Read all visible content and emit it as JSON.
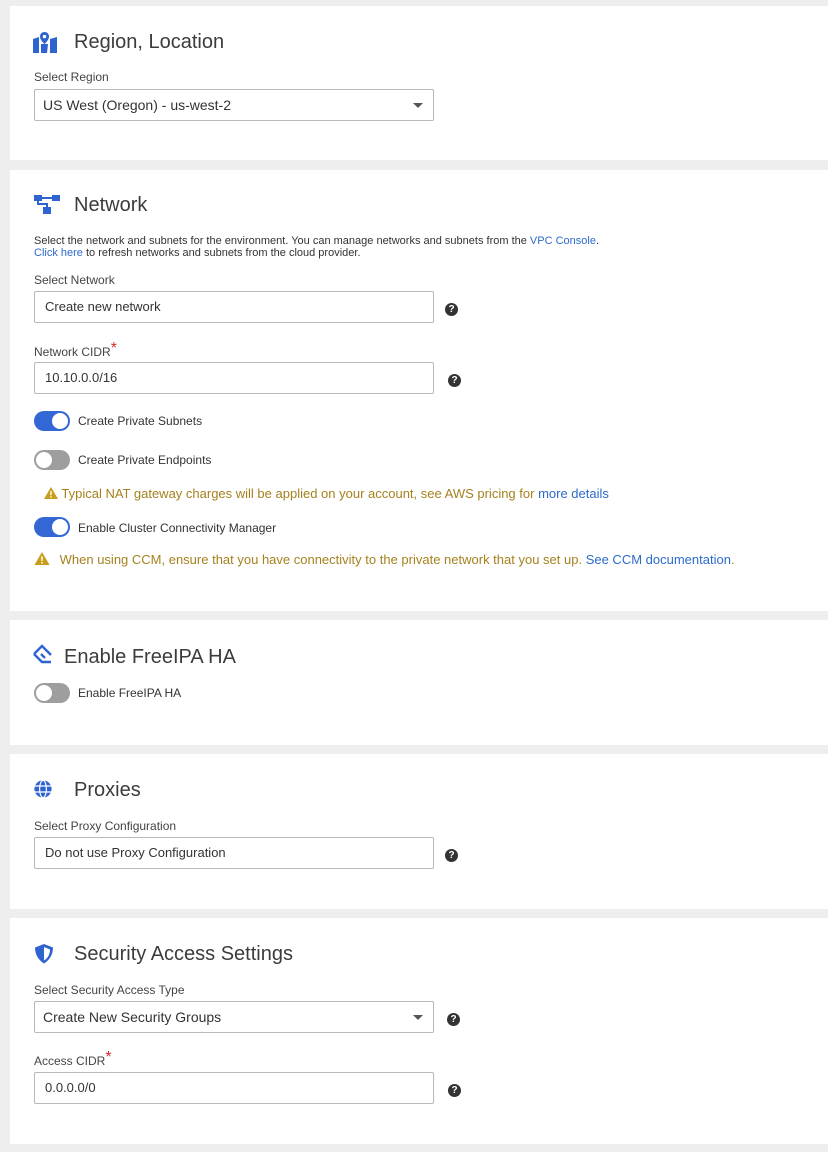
{
  "region": {
    "title": "Region, Location",
    "select_label": "Select Region",
    "select_value": "US West (Oregon) - us-west-2"
  },
  "network": {
    "title": "Network",
    "description_prefix": "Select the network and subnets for the environment. You can manage networks and subnets from the ",
    "vpc_link": "VPC Console",
    "description_period": ".",
    "click_here": "Click here",
    "refresh_text": " to refresh networks and subnets from the cloud provider.",
    "select_network_label": "Select Network",
    "select_network_value": "Create new network",
    "cidr_label": "Network CIDR",
    "required_mark": "*",
    "cidr_value": "10.10.0.0/16",
    "toggle_private_subnets": "Create Private Subnets",
    "toggle_private_endpoints": "Create Private Endpoints",
    "nat_warning": "Typical NAT gateway charges will be applied on your account, see AWS pricing for ",
    "nat_link": "more details",
    "toggle_ccm": "Enable Cluster Connectivity Manager",
    "ccm_warning": "When using CCM, ensure that you have connectivity to the private network that you set up. ",
    "ccm_link": "See CCM documentation",
    "ccm_period": "."
  },
  "freeipa": {
    "title": "Enable FreeIPA HA",
    "toggle_label": "Enable FreeIPA HA"
  },
  "proxies": {
    "title": "Proxies",
    "select_label": "Select Proxy Configuration",
    "select_value": "Do not use Proxy Configuration"
  },
  "security": {
    "title": "Security Access Settings",
    "type_label": "Select Security Access Type",
    "type_value": "Create New Security Groups",
    "cidr_label": "Access CIDR",
    "required_mark": "*",
    "cidr_value": "0.0.0.0/0"
  },
  "help_glyph": "?",
  "warning_glyph": "!",
  "toggles": {
    "private_subnets": true,
    "private_endpoints": false,
    "ccm": true,
    "freeipa_ha": false
  },
  "colors": {
    "accent": "#3367d6",
    "link": "#2d6acc",
    "warning_text": "#a5811e",
    "warning_icon": "#c89d1c",
    "required": "#d32f2f",
    "icon_blue": "#2f64d0"
  },
  "icons": {
    "region": "map-marker-icon",
    "network": "network-topology-icon",
    "freeipa": "diamond-tag-icon",
    "proxies": "globe-icon",
    "security": "shield-icon",
    "help": "question-circle-icon",
    "warning": "warning-triangle-icon",
    "caret": "chevron-down-icon"
  }
}
